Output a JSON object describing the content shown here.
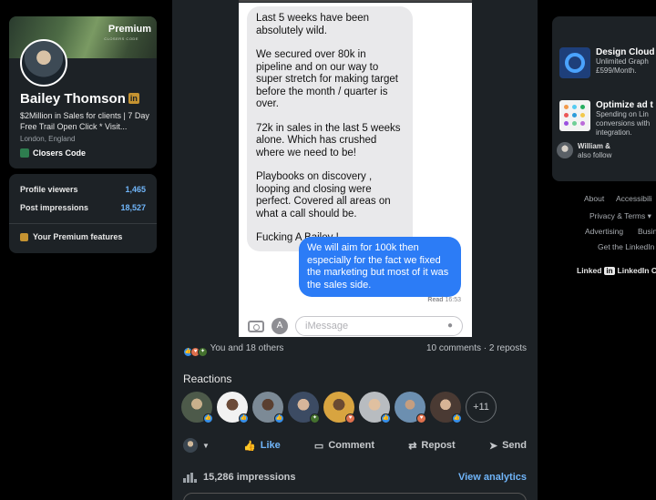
{
  "profile": {
    "premium_label": "Premium",
    "banner_logo_text": "CLOSERS CODE",
    "name": "Bailey Thomson",
    "badge": "in",
    "headline": "$2Million in Sales for clients | 7 Day Free Trail Open Click * Visit...",
    "location": "London, England",
    "company": "Closers Code"
  },
  "stats": {
    "viewers_label": "Profile viewers",
    "viewers_value": "1,465",
    "impressions_label": "Post impressions",
    "impressions_value": "18,527",
    "premium_features": "Your Premium features"
  },
  "chat": {
    "incoming": [
      "Last 5 weeks have been absolutely wild.",
      "We secured over 80k in pipeline and on our way to super stretch for making target before the month / quarter is over.",
      "72k in sales in the last 5 weeks alone. Which has crushed where we need to be!",
      "Playbooks on discovery , looping and closing were perfect. Covered all areas on what a call should be.",
      "Fucking A Bailey !"
    ],
    "outgoing": "We will aim for 100k then especially for the fact we fixed the marketing but most of it was the sales side.",
    "read_label": "Read",
    "read_time": "16:53",
    "input_placeholder": "iMessage"
  },
  "post": {
    "reactions_summary": "You and 18 others",
    "comments_reposts": "10 comments · 2 reposts",
    "reactions_title": "Reactions",
    "more_reactors": "+11",
    "actions": {
      "like": "Like",
      "comment": "Comment",
      "repost": "Repost",
      "send": "Send"
    },
    "impressions": "15,286 impressions",
    "view_analytics": "View analytics"
  },
  "ads": [
    {
      "title": "Design Cloud",
      "lines": [
        "Unlimited Graph",
        "£599/Month."
      ]
    },
    {
      "title": "Optimize ad t",
      "lines": [
        "Spending on Lin",
        "conversions with",
        "integration."
      ]
    }
  ],
  "ad_social": {
    "line1": "William &",
    "line2": "also follow"
  },
  "footer": {
    "about": "About",
    "accessibility": "Accessibili",
    "privacy": "Privacy & Terms ▾",
    "advertising": "Advertising",
    "business": "Busin",
    "get_app": "Get the LinkedIn",
    "brand_logo": "in",
    "brand_text": "LinkedIn Co"
  },
  "colors": {
    "accent": "#70b5f9",
    "premium_gold": "#c59331",
    "imessage_blue": "#2c7cf6",
    "card_bg": "#1d2226"
  }
}
